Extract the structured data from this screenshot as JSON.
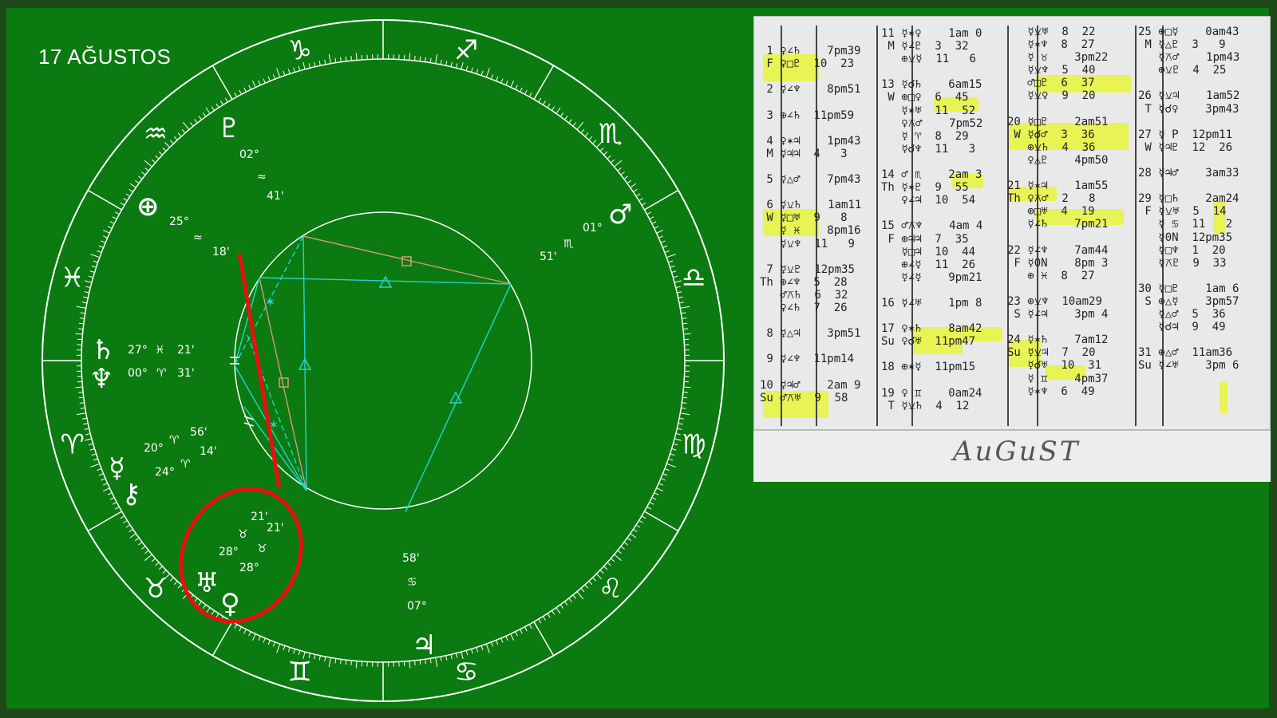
{
  "title": "17 AĞUSTOS",
  "wheel": {
    "signs": [
      "♑",
      "♐",
      "♏",
      "♎",
      "♍",
      "♌",
      "♋",
      "♊",
      "♉",
      "♈",
      "♓",
      "♒"
    ],
    "planets": [
      {
        "glyph": "♇",
        "deg": "02°",
        "sign": "≈",
        "min": "41'"
      },
      {
        "glyph": "⊕",
        "deg": "25°",
        "sign": "≈",
        "min": "18'"
      },
      {
        "glyph": "♂",
        "deg": "01°",
        "sign": "♏",
        "min": "51'"
      },
      {
        "glyph": "♄",
        "deg": "27°",
        "sign": "♓",
        "min": "21'"
      },
      {
        "glyph": "♆",
        "deg": "00°",
        "sign": "♈",
        "min": "31'"
      },
      {
        "glyph": "☿",
        "deg": "20°",
        "sign": "♈",
        "min": "56'"
      },
      {
        "glyph": "⚷",
        "deg": "24°",
        "sign": "♈",
        "min": "14'"
      },
      {
        "glyph": "♅",
        "deg": "28°",
        "sign": "♉",
        "min": "21'"
      },
      {
        "glyph": "♀",
        "deg": "28°",
        "sign": "♉",
        "min": "21'"
      },
      {
        "glyph": "♃",
        "deg": "07°",
        "sign": "♋",
        "min": "58'"
      }
    ]
  },
  "ephemeris": {
    "footer": "AuGuST",
    "col1": "\n 1 ♀∠♄    7pm39\n F ♀□♇  10  23\n\n 2 ☿∠♆    8pm51\n\n 3 ⊕∠♄  11pm59\n\n 4 ♀✶♃    1pm43\n M ☿♃♃  4   3\n\n 5 ☿△♂    7pm43\n\n 6 ☿⚺♄    1am11\n W ☿□♅  9   8\n   ☿ ♓    8pm16\n   ☿⚺♆  11   9\n\n 7 ☿⚺♇  12pm35\nTh ⊕∠♆  5  28\n   ♂⚻♄  6  32\n   ♀∠♄  7  26\n\n 8 ☿△♃    3pm51\n\n 9 ☿∠♆  11pm14\n\n10 ☿♃♂    2am 9\nSu ♂⚻♅  9  58",
    "col2": "11 ☿✶♀    1am 0\n M ☿∠♇  3  32\n   ⊕⚺☿  11   6\n\n13 ☿☌♄    6am15\n W ⊕□♀  6  45\n   ☿✶♅  11  52\n   ♀⚻♂    7pm52\n   ☿ ♈  8  29\n   ☿☌♆  11   3\n\n14 ♂ ♏    2am 3\nTh ☿✶♇  9  55\n   ♀∠♃  10  54\n\n15 ♂⚻♆    4am 4\n F ⊕♃♃  7  35\n   ☿□♃  10  44\n   ⊕∠☿  11  26\n   ☿∠☿    9pm21\n\n16 ☿∠♅    1pm 8\n\n17 ♀✶♄    8am42\nSu ♀☌♅  11pm47\n\n18 ⊕✶☿  11pm15\n\n19 ♀ ♊    0am24\n T ☿⚺♄  4  12",
    "col3": "   ☿⚺♅  8  22\n   ☿✶♆  8  27\n   ☿ ♉    3pm22\n   ☿⚺♆  5  40\n   ♂□♇  6  37\n   ☿⚺♀  9  20\n\n20 ☿□♇    2am51\n W ☿☌♂  3  36\n   ⊕⚺♄  4  36\n   ♀△♇    4pm50\n\n21 ☿✶♃    1am55\nTh ♀⚻♂  2   8\n   ⊕□♅  4  19\n   ☿∠♄    7pm21\n\n22 ☿∠♆    7am44\n F ☿0N    8pm 3\n   ⊕ ♓  8  27\n\n23 ⊕⚺♆  10am29\n S ☿∠♃    3pm 4\n\n24 ☿✶♄    7am12\nSu ☿⚺♃  7  20\n   ☿☌♅  10  31\n   ☿ ♊    4pm37\n   ☿✶♆  6  49",
    "col4": "25 ⊕□☿    0am43\n M ☿△♇  3   9\n   ☿⚻♂    1pm43\n   ⊕⚺♇  4  25\n\n26 ☿⚺♃    1am52\n T ☿☌♀    3pm43\n\n27 ☿ P  12pm11\n W ☿♃♇  12  26\n\n28 ☿♃♂    3am33\n\n29 ☿□♄    2am24\n F ☿⚺♅  5  14\n   ☿ ♋  11   2\n   ☿0N  12pm35\n   ☿□♆  1  20\n   ☿⚻♇  9  33\n\n30 ☿□♇    1am 6\n S ⊕△☿    3pm57\n   ☿△♂  5  36\n   ☿☌♃  9  49\n\n31 ⊕△♂  11am36\nSu ☿∠♅    3pm 6"
  }
}
